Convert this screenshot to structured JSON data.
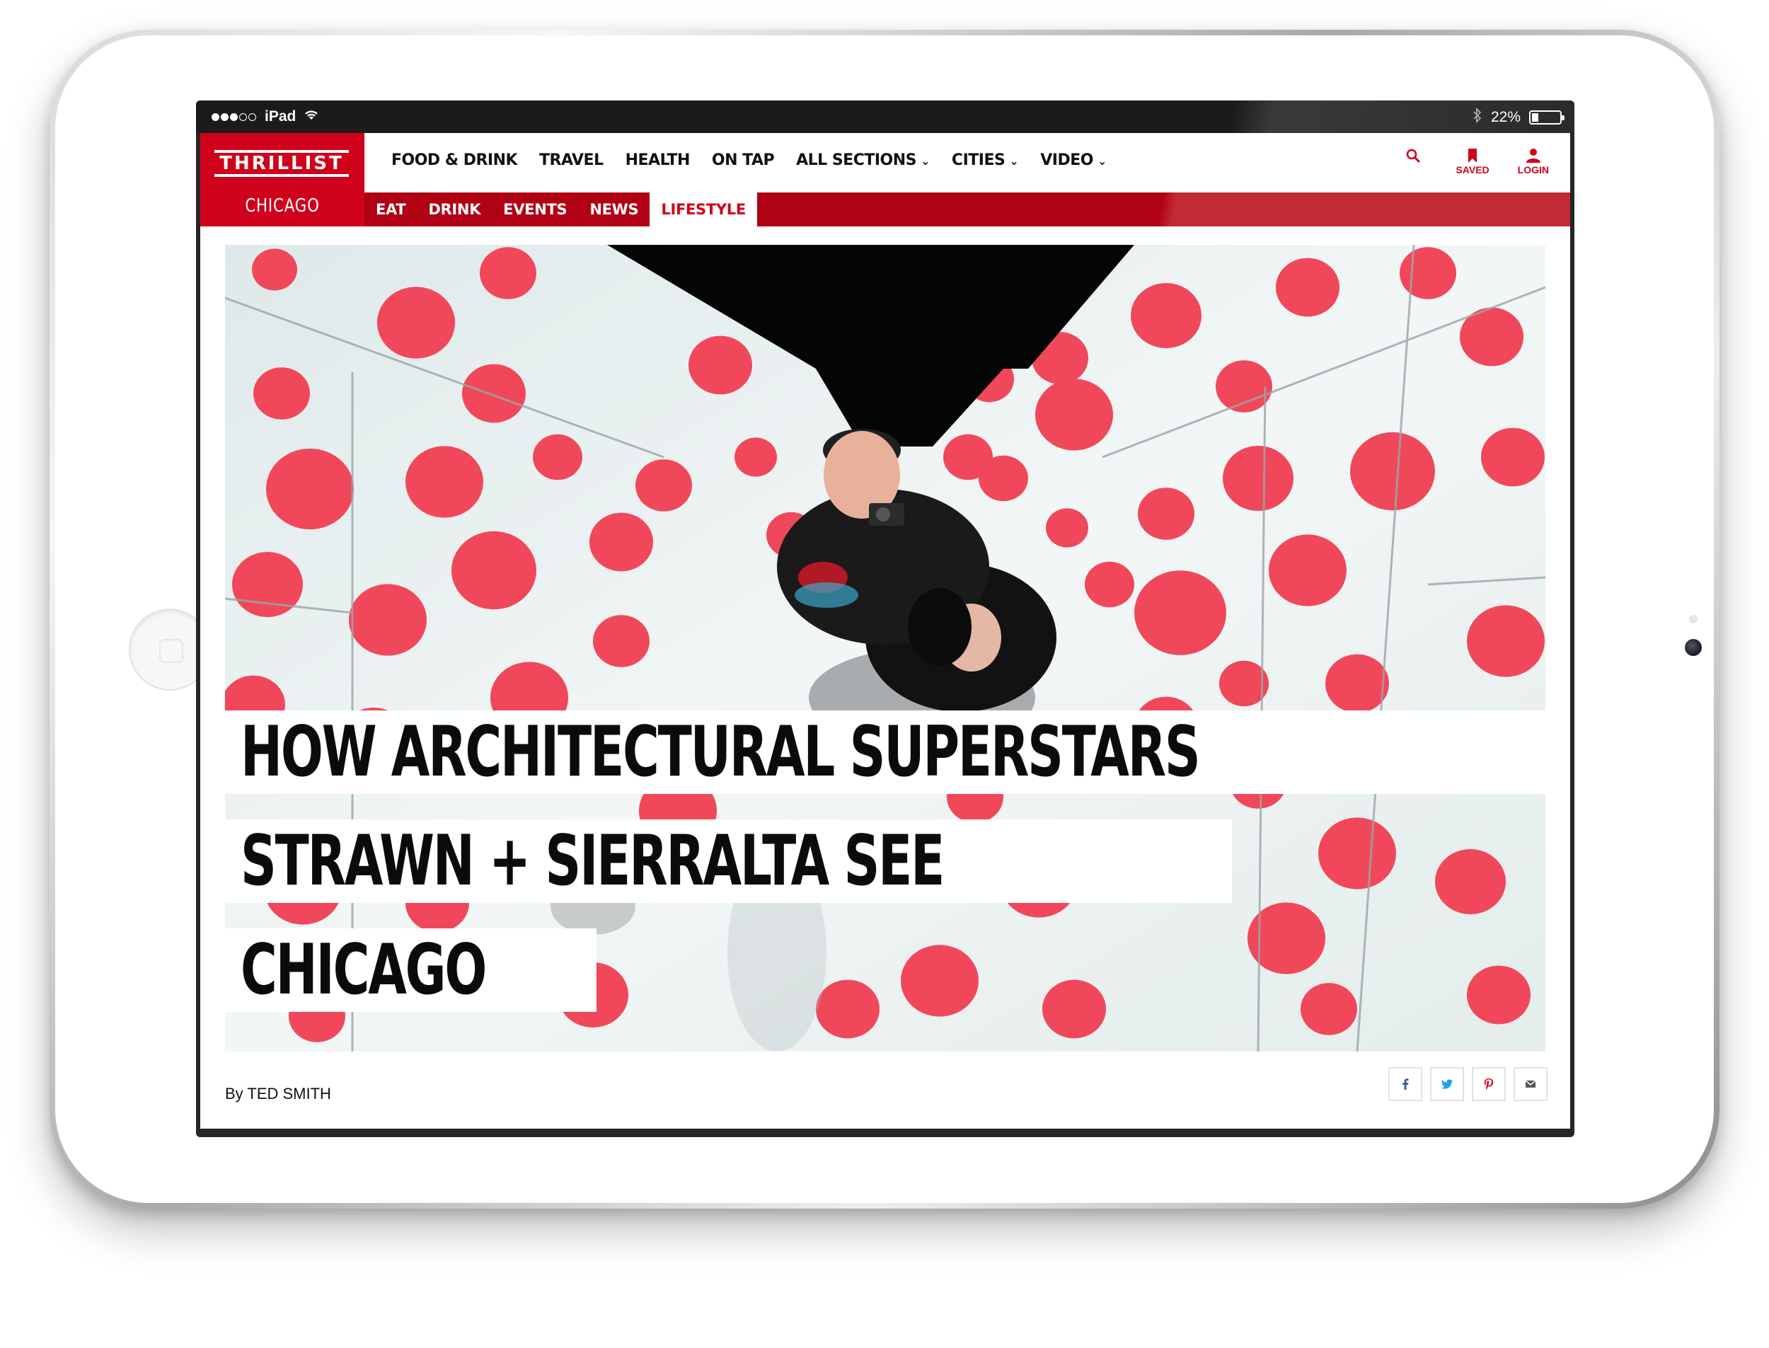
{
  "status_bar": {
    "carrier": "iPad",
    "battery_text": "22%",
    "battery_level": 0.22,
    "signal_bars_filled": 3,
    "signal_bars_total": 5
  },
  "site": {
    "logo": "THRILLIST",
    "city": "CHICAGO",
    "brand_color": "#d0021b"
  },
  "primary_nav": [
    {
      "label": "FOOD & DRINK",
      "dropdown": false
    },
    {
      "label": "TRAVEL",
      "dropdown": false
    },
    {
      "label": "HEALTH",
      "dropdown": false
    },
    {
      "label": "ON TAP",
      "dropdown": false
    },
    {
      "label": "ALL SECTIONS",
      "dropdown": true
    },
    {
      "label": "CITIES",
      "dropdown": true
    },
    {
      "label": "VIDEO",
      "dropdown": true
    }
  ],
  "nav_actions": {
    "search_icon": "search-icon",
    "saved_label": "SAVED",
    "login_label": "LOGIN"
  },
  "section_tabs": [
    {
      "label": "EAT",
      "active": false
    },
    {
      "label": "DRINK",
      "active": false
    },
    {
      "label": "EVENTS",
      "active": false
    },
    {
      "label": "NEWS",
      "active": false
    },
    {
      "label": "LIFESTYLE",
      "active": true
    }
  ],
  "article": {
    "headline_lines": [
      "HOW ARCHITECTURAL SUPERSTARS",
      "STRAWN + SIERRALTA SEE",
      "CHICAGO"
    ],
    "byline": "By TED SMITH",
    "hero_colors": {
      "dot": "#f0485a",
      "wall": "#e8f0f0"
    }
  },
  "share_buttons": [
    {
      "icon": "facebook-icon",
      "color": "#3b5998"
    },
    {
      "icon": "twitter-icon",
      "color": "#1da1f2"
    },
    {
      "icon": "pinterest-icon",
      "color": "#d0021b"
    },
    {
      "icon": "email-icon",
      "color": "#555555"
    }
  ]
}
